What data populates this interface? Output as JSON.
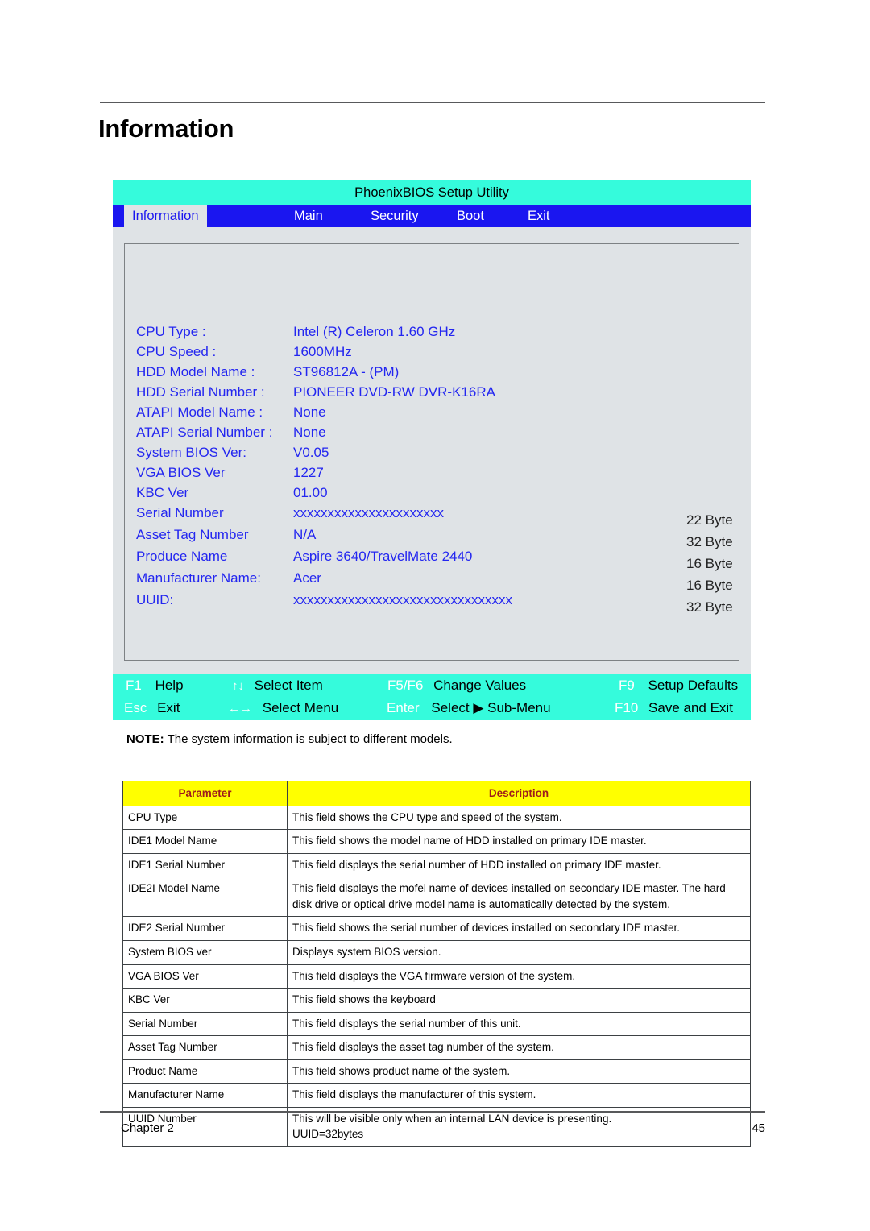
{
  "page": {
    "title": "Information",
    "chapter": "Chapter 2",
    "page_number": "45"
  },
  "bios": {
    "window_title": "PhoenixBIOS Setup Utility",
    "tabs": [
      {
        "label": "Information",
        "active": true
      },
      {
        "label": "Main",
        "active": false
      },
      {
        "label": "Security",
        "active": false
      },
      {
        "label": "Boot",
        "active": false
      },
      {
        "label": "Exit",
        "active": false
      }
    ],
    "fields": [
      {
        "label": "CPU Type :",
        "value": "Intel (R) Celeron 1.60 GHz"
      },
      {
        "label": "CPU Speed :",
        "value": "1600MHz"
      },
      {
        "label": "HDD Model Name :",
        "value": "ST96812A - (PM)"
      },
      {
        "label": "HDD Serial Number :",
        "value": "PIONEER DVD-RW DVR-K16RA"
      },
      {
        "label": "ATAPI Model Name :",
        "value": "None"
      },
      {
        "label": "ATAPI Serial Number :",
        "value": "None"
      },
      {
        "label": "System BIOS Ver:",
        "value": "V0.05"
      },
      {
        "label": "VGA BIOS Ver",
        "value": "1227"
      },
      {
        "label": "KBC Ver",
        "value": "01.00"
      },
      {
        "label": "Serial Number",
        "value": "xxxxxxxxxxxxxxxxxxxxxx"
      },
      {
        "label": "Asset Tag Number",
        "value": "N/A"
      },
      {
        "label": "Produce Name",
        "value": "Aspire 3640/TravelMate 2440"
      },
      {
        "label": "Manufacturer Name:",
        "value": "Acer"
      },
      {
        "label": "UUID:",
        "value": "xxxxxxxxxxxxxxxxxxxxxxxxxxxxxxxx"
      }
    ],
    "byte_notes": [
      "22 Byte",
      "32 Byte",
      "16 Byte",
      "16 Byte",
      "32 Byte"
    ],
    "function_keys": [
      {
        "key": "F1",
        "arrows": "",
        "label": "Help"
      },
      {
        "key": "",
        "arrows": "↑↓",
        "label": "Select Item"
      },
      {
        "key": "F5/F6",
        "arrows": "",
        "label": "Change Values"
      },
      {
        "key": "F9",
        "arrows": "",
        "label": "Setup Defaults"
      },
      {
        "key": "Esc",
        "arrows": "",
        "label": "Exit"
      },
      {
        "key": "",
        "arrows": "←→",
        "label": "Select Menu"
      },
      {
        "key": "Enter",
        "arrows": "",
        "label": "Select ▶ Sub-Menu"
      },
      {
        "key": "F10",
        "arrows": "",
        "label": "Save and Exit"
      }
    ]
  },
  "note": {
    "prefix": "NOTE:",
    "text": " The system information is subject to different models."
  },
  "table": {
    "headers": [
      "Parameter",
      "Description"
    ],
    "rows": [
      {
        "parameter": "CPU Type",
        "description": "This field shows the CPU type and speed of the system."
      },
      {
        "parameter": "IDE1 Model Name",
        "description": "This field shows the model name of HDD installed on primary IDE master."
      },
      {
        "parameter": "IDE1 Serial Number",
        "description": "This field displays the serial number of HDD installed on primary IDE master."
      },
      {
        "parameter": "IDE2I Model Name",
        "description": "This field displays the mofel name of devices installed on secondary IDE master. The hard disk drive or optical drive model name is automatically detected by the system."
      },
      {
        "parameter": "IDE2 Serial Number",
        "description": "This field shows the serial number of devices installed on secondary IDE master."
      },
      {
        "parameter": "System BIOS ver",
        "description": "Displays system BIOS version."
      },
      {
        "parameter": "VGA BIOS Ver",
        "description": "This field displays the VGA firmware version of the system."
      },
      {
        "parameter": "KBC Ver",
        "description": "This field shows the keyboard"
      },
      {
        "parameter": "Serial Number",
        "description": "This field displays the serial number of this unit."
      },
      {
        "parameter": "Asset Tag Number",
        "description": "This field displays the asset tag number of the system."
      },
      {
        "parameter": "Product Name",
        "description": "This field shows product name of the system."
      },
      {
        "parameter": "Manufacturer Name",
        "description": "This field displays the manufacturer of this system."
      },
      {
        "parameter": "UUID Number",
        "description": "This will be visible only when an internal LAN device is presenting.",
        "description2": "UUID=32bytes"
      }
    ]
  },
  "colors": {
    "bios_title_bar": "#35fbdc",
    "bios_tab_bar": "#1a16f0",
    "bios_body": "#dfe3e6",
    "bios_text": "#2326f0",
    "table_header_bg": "#ffff00",
    "table_header_fg": "#9e1b1b"
  }
}
